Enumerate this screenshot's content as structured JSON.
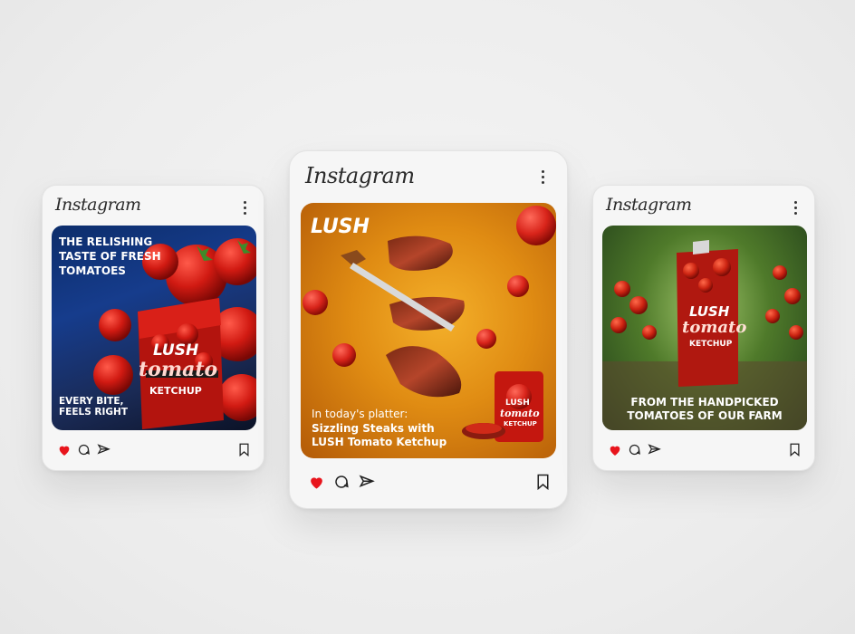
{
  "posts": [
    {
      "app_name": "Instagram",
      "headline": "THE RELISHING TASTE OF FRESH TOMATOES",
      "tagline": "EVERY BITE, FEELS RIGHT",
      "brand": "LUSH",
      "product": "tomato",
      "product_sub": "KETCHUP",
      "liked": true,
      "like_color": "#e8141c"
    },
    {
      "app_name": "Instagram",
      "brand": "LUSH",
      "caption_intro": "In today's platter:",
      "caption_main": "Sizzling Steaks with LUSH Tomato Ketchup",
      "product": "tomato",
      "product_sub": "KETCHUP",
      "liked": true,
      "like_color": "#e8141c"
    },
    {
      "app_name": "Instagram",
      "brand": "LUSH",
      "product": "tomato",
      "product_sub": "KETCHUP",
      "headline": "FROM THE HANDPICKED TOMATOES OF OUR FARM",
      "liked": true,
      "like_color": "#e8141c"
    }
  ],
  "icons": {
    "like": "heart-icon",
    "comment": "comment-icon",
    "share": "send-icon",
    "save": "bookmark-icon",
    "menu": "more-options-icon"
  }
}
